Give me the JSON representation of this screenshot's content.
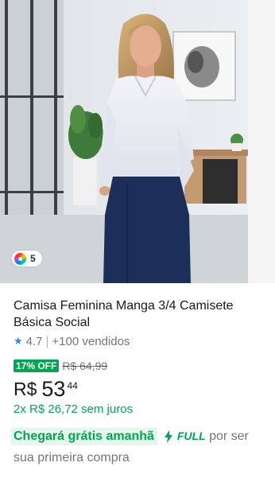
{
  "product": {
    "variant_count": "5",
    "title": "Camisa Feminina Manga 3/4 Camisete Básica Social",
    "rating": "4.7",
    "separator": "|",
    "sales": "+100 vendidos",
    "discount": "17% OFF",
    "old_price": "R$ 64,99",
    "price_currency": "R$",
    "price_integer": "53",
    "price_cents": "44",
    "installments": "2x R$ 26,72 sem juros",
    "shipping_highlight": "Chegará grátis amanhã",
    "shipping_full": "FULL",
    "shipping_suffix": "por ser sua primeira compra"
  },
  "colors": {
    "green": "#00a650",
    "star_blue": "#3483fa"
  },
  "icons": {
    "rating": "star-icon",
    "variants": "color-wheel-icon",
    "full": "lightning-bolt-icon"
  }
}
